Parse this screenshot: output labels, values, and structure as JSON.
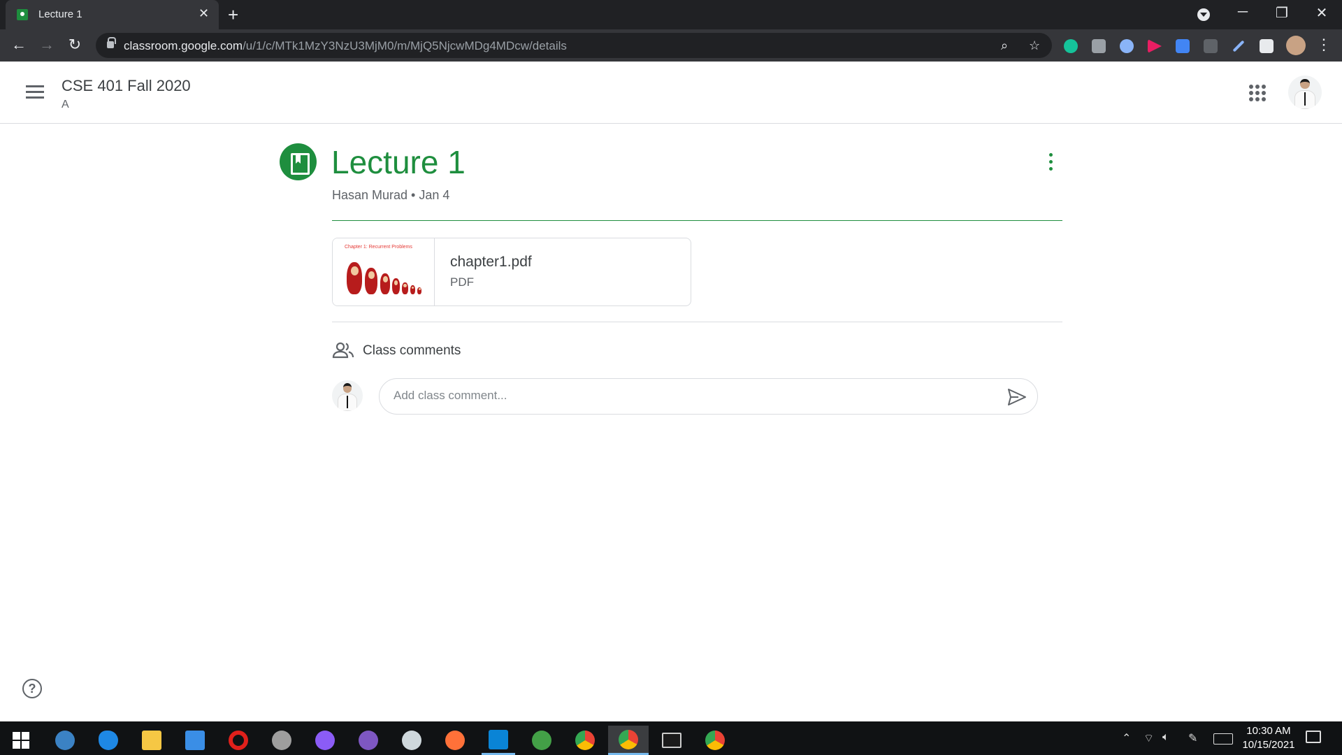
{
  "browser": {
    "tab_title": "Lecture 1",
    "url_host": "classroom.google.com",
    "url_path": "/u/1/c/MTk1MzY3NzU3MjM0/m/MjQ5NjcwMDg4MDcw/details"
  },
  "header": {
    "class_title": "CSE 401 Fall 2020",
    "class_section": "A"
  },
  "post": {
    "title": "Lecture 1",
    "meta": "Hasan Murad • Jan 4",
    "accent_color": "#1e8e3e"
  },
  "attachment": {
    "thumbnail_caption": "Chapter 1: Recurrent Problems",
    "name": "chapter1.pdf",
    "type": "PDF"
  },
  "comments": {
    "label": "Class comments",
    "placeholder": "Add class comment..."
  },
  "taskbar": {
    "time": "10:30 AM",
    "date": "10/15/2021"
  }
}
